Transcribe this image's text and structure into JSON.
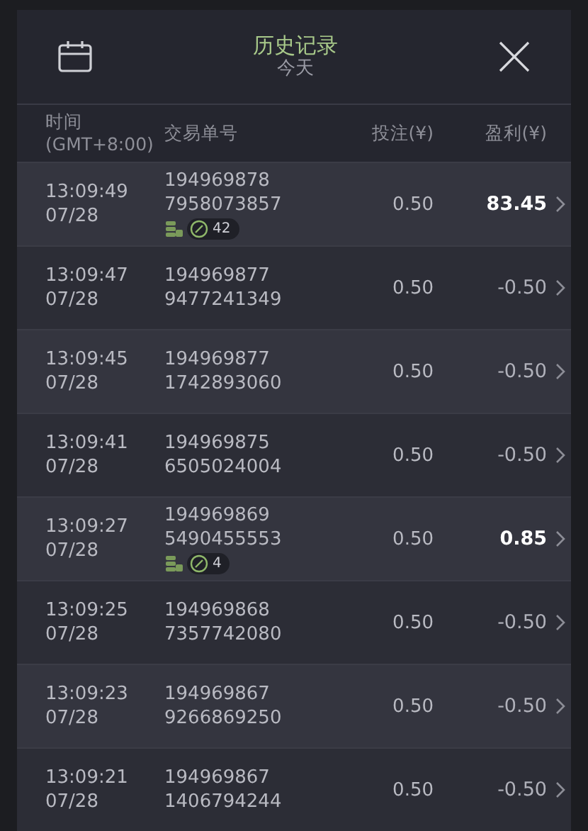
{
  "header": {
    "title": "历史记录",
    "subtitle": "今天"
  },
  "columns": [
    {
      "label": "时间\n(GMT+8:00)"
    },
    {
      "label": "交易单号"
    },
    {
      "label": "投注(¥)"
    },
    {
      "label": "盈利(¥)"
    }
  ],
  "rows": [
    {
      "time": "13:09:49",
      "date": "07/28",
      "id_1": "194969878",
      "id_2": "7958073857",
      "badge": {
        "count": "42"
      },
      "stake": "0.50",
      "profit": "83.45",
      "win": true
    },
    {
      "time": "13:09:47",
      "date": "07/28",
      "id_1": "194969877",
      "id_2": "9477241349",
      "stake": "0.50",
      "profit": "-0.50",
      "win": false
    },
    {
      "time": "13:09:45",
      "date": "07/28",
      "id_1": "194969877",
      "id_2": "1742893060",
      "stake": "0.50",
      "profit": "-0.50",
      "win": false
    },
    {
      "time": "13:09:41",
      "date": "07/28",
      "id_1": "194969875",
      "id_2": "6505024004",
      "stake": "0.50",
      "profit": "-0.50",
      "win": false
    },
    {
      "time": "13:09:27",
      "date": "07/28",
      "id_1": "194969869",
      "id_2": "5490455553",
      "badge": {
        "count": "4"
      },
      "stake": "0.50",
      "profit": "0.85",
      "win": true
    },
    {
      "time": "13:09:25",
      "date": "07/28",
      "id_1": "194969868",
      "id_2": "7357742080",
      "stake": "0.50",
      "profit": "-0.50",
      "win": false
    },
    {
      "time": "13:09:23",
      "date": "07/28",
      "id_1": "194969867",
      "id_2": "9266869250",
      "stake": "0.50",
      "profit": "-0.50",
      "win": false
    },
    {
      "time": "13:09:21",
      "date": "07/28",
      "id_1": "194969867",
      "id_2": "1406794244",
      "stake": "0.50",
      "profit": "-0.50",
      "win": false
    }
  ]
}
